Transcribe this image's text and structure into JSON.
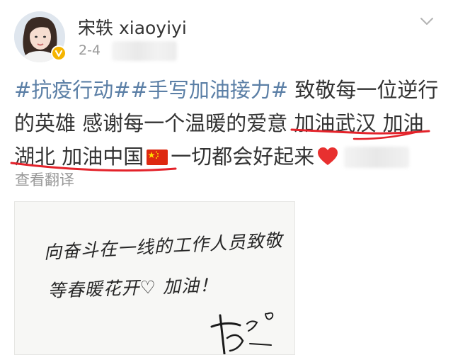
{
  "user": {
    "name": "宋轶 xiaoyiyi",
    "date": "2-4",
    "verified_color": "#f5b400"
  },
  "post": {
    "lines": [
      [
        "#抗疫行动##手写加油接力#",
        " 致敬每一位逆行"
      ],
      [
        "的英雄 感谢每一个温暖的爱意 加油武汉 加油"
      ],
      [
        "湖北 加油中国",
        "一切都会好起来"
      ]
    ],
    "hashtag_color": "#5b7fa6",
    "underline_color": "#e3222a",
    "translate_label": "查看翻译",
    "icons": [
      "china-flag-icon",
      "red-heart-icon",
      "chevron-down-icon",
      "verified-badge-icon"
    ]
  },
  "photo": {
    "handwriting_line1": "向奋斗在一线的工作人员致敬",
    "handwriting_line2": "等春暖花开♡ 加油！"
  }
}
